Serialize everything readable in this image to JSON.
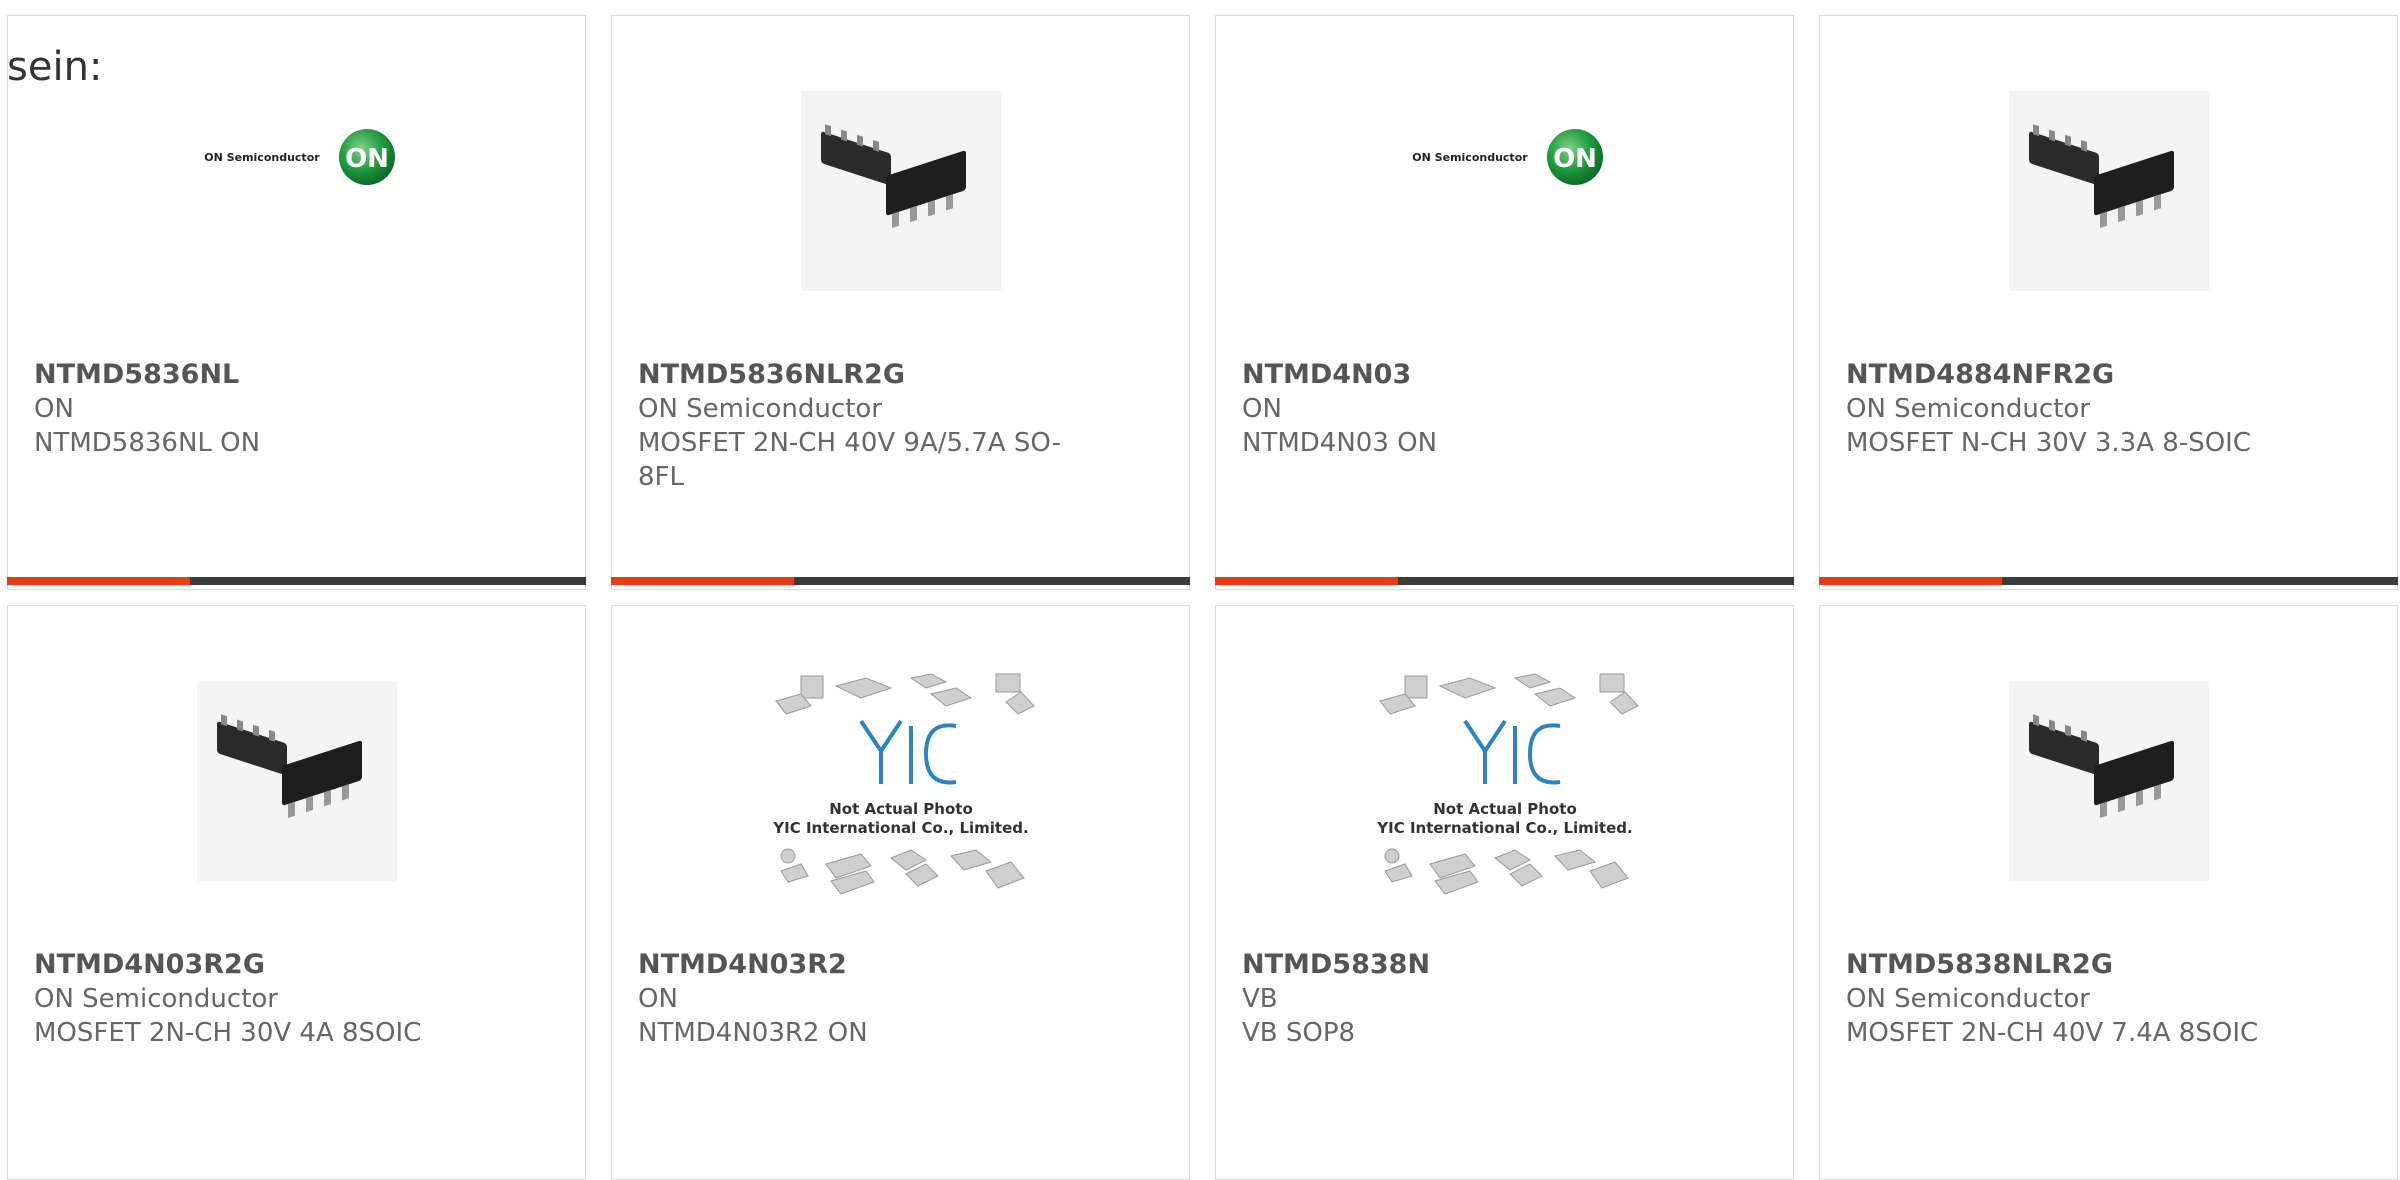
{
  "intro": "sein:",
  "colors": {
    "accent": "#e13e15",
    "bar": "#3b3b3b"
  },
  "cards": [
    {
      "part": "NTMD5836NL",
      "mfr": "ON",
      "desc": "NTMD5836NL ON",
      "image": "on-semi-logo"
    },
    {
      "part": "NTMD5836NLR2G",
      "mfr": "ON Semiconductor",
      "desc": "MOSFET 2N-CH 40V 9A/5.7A SO-8FL",
      "image": "soic8-chip-photo"
    },
    {
      "part": "NTMD4N03",
      "mfr": "ON",
      "desc": "NTMD4N03 ON",
      "image": "on-semi-logo"
    },
    {
      "part": "NTMD4884NFR2G",
      "mfr": "ON Semiconductor",
      "desc": "MOSFET N-CH 30V 3.3A 8-SOIC",
      "image": "soic8-chip-photo"
    },
    {
      "part": "NTMD4N03R2G",
      "mfr": "ON Semiconductor",
      "desc": "MOSFET 2N-CH 30V 4A 8SOIC",
      "image": "soic8-chip-photo"
    },
    {
      "part": "NTMD4N03R2",
      "mfr": "ON",
      "desc": "NTMD4N03R2 ON",
      "image": "yic-placeholder"
    },
    {
      "part": "NTMD5838N",
      "mfr": "VB",
      "desc": "VB SOP8",
      "image": "yic-placeholder"
    },
    {
      "part": "NTMD5838NLR2G",
      "mfr": "ON Semiconductor",
      "desc": "MOSFET 2N-CH 40V 7.4A 8SOIC",
      "image": "soic8-chip-photo"
    }
  ],
  "labels": {
    "on_logo_text": "ON Semiconductor",
    "on_badge": "ON",
    "yic_line1": "Not Actual Photo",
    "yic_line2": "YIC International Co., Limited.",
    "yic_mark": "YIC"
  }
}
